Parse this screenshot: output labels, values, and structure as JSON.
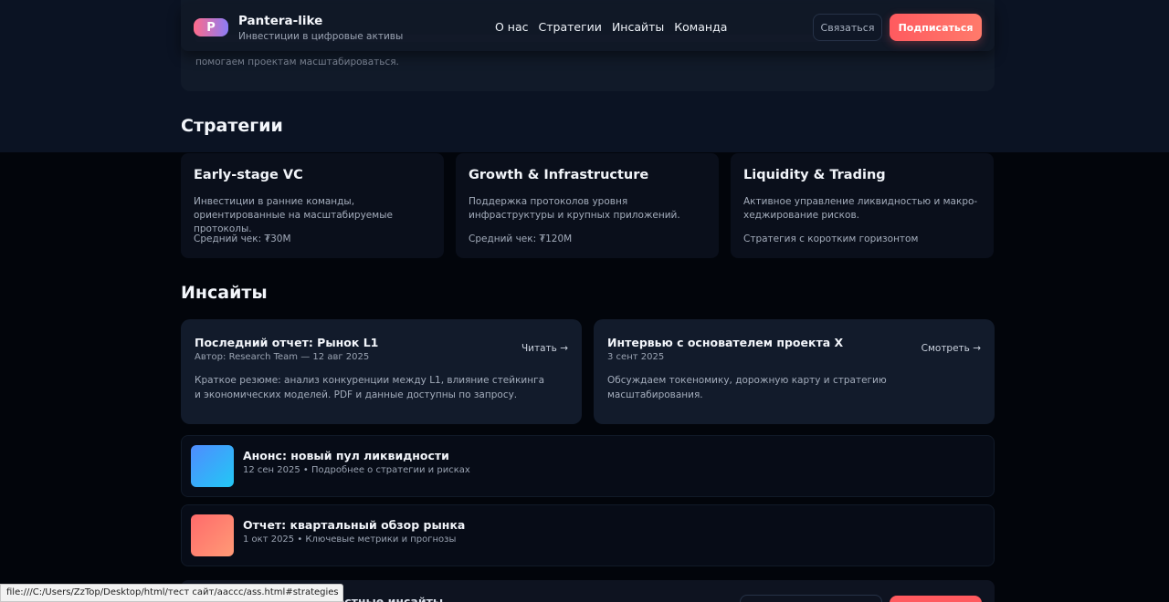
{
  "brand": {
    "logo_letter": "P",
    "name": "Pantera-like",
    "tagline": "Инвестиции в цифровые активы"
  },
  "nav": {
    "items": [
      {
        "label": "О нас"
      },
      {
        "label": "Стратегии"
      },
      {
        "label": "Инсайты"
      },
      {
        "label": "Команда"
      }
    ]
  },
  "header_actions": {
    "contact_label": "Связаться",
    "subscribe_label": "Подписаться"
  },
  "about": {
    "text_tail": "помогаем проектам масштабироваться."
  },
  "strategies": {
    "title": "Стратегии",
    "cards": [
      {
        "title": "Early-stage VC",
        "description": "Инвестиции в ранние команды, ориентированные на масштабируемые протоколы.",
        "meta": "Средний чек: ₮30M"
      },
      {
        "title": "Growth & Infrastructure",
        "description": "Поддержка протоколов уровня инфраструктуры и крупных приложений.",
        "meta": "Средний чек: ₮120M"
      },
      {
        "title": "Liquidity & Trading",
        "description": "Активное управление ликвидностью и макро-хеджирование рисков.",
        "meta": "Стратегия с коротким горизонтом"
      }
    ]
  },
  "insights": {
    "title": "Инсайты",
    "cards": [
      {
        "title": "Последний отчет: Рынок L1",
        "meta": "Автор: Research Team — 12 авг 2025",
        "action": "Читать →",
        "description": "Краткое резюме: анализ конкуренции между L1, влияние стейкинга и экономических моделей. PDF и данные доступны по запросу."
      },
      {
        "title": "Интервью с основателем проекта X",
        "meta": "3 сент 2025",
        "action": "Смотреть →",
        "description": "Обсуждаем токеномику, дорожную карту и стратегию масштабирования."
      }
    ]
  },
  "feed": {
    "items": [
      {
        "title": "Анонс: новый пул ликвидности",
        "meta": "12 сен 2025 • Подробнее о стратегии и рисках",
        "thumb_gradient": [
          "#4f8cff",
          "#22c8f5"
        ]
      },
      {
        "title": "Отчет: квартальный обзор рынка",
        "meta": "1 окт 2025 • Ключевые метрики и прогнозы",
        "thumb_gradient": [
          "#ff6b6b",
          "#ff9a76"
        ]
      }
    ]
  },
  "bottom_partial": {
    "text": "…местные инсайты"
  },
  "browser_status": {
    "url": "file:///C:/Users/ZzTop/Desktop/html/тест сайт/aaccc/ass.html#strategies"
  },
  "colors": {
    "accent": "#ff5a5f",
    "background": "#02050b",
    "card": "#121b2b"
  }
}
